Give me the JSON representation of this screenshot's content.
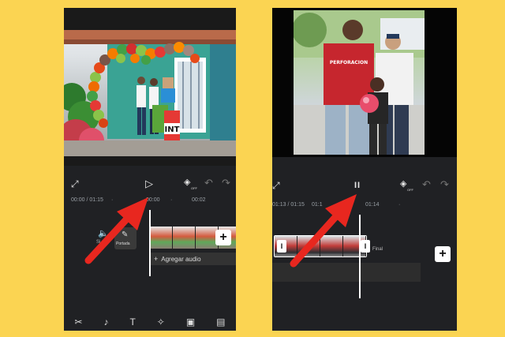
{
  "left": {
    "timecode": "00:00 / 01:15",
    "ticks": [
      "00:00",
      "00:02"
    ],
    "tick_dots": [
      "·",
      "·"
    ],
    "audio_label": "Agregar audio",
    "add_audio_plus": "+",
    "cover_label": "Portada",
    "sound_label": "Si",
    "add_clip": "+",
    "play_symbol": "▷"
  },
  "right": {
    "timecode": "01:13 / 01:15",
    "ticks": [
      "01:1",
      "01:14"
    ],
    "tick_dots": [
      "·"
    ],
    "final_label": "Final",
    "add_clip": "+",
    "pause_symbol": "II",
    "left_handle": "I",
    "right_handle": "I"
  },
  "photo_left": {
    "banner_text": "INT"
  },
  "photo_right": {
    "shirt_text": "PERFORACION"
  },
  "icons": {
    "fullscreen": "⤢",
    "undo": "↶",
    "redo": "↷",
    "keyframe": "◈",
    "off_badge": "OFF",
    "toolbar": [
      "✂",
      "♪",
      "T",
      "✧",
      "▣",
      "▤"
    ]
  },
  "colors": {
    "background": "#fbd452",
    "arrow": "#e8271f",
    "phone": "#202124"
  }
}
